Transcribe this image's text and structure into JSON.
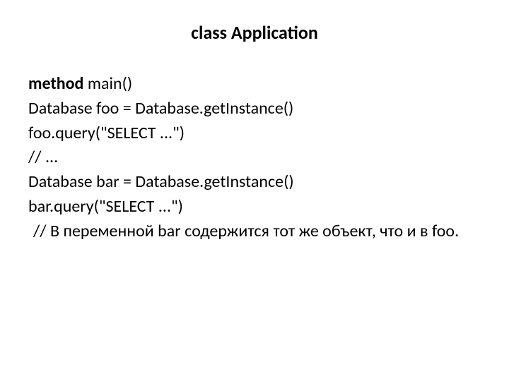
{
  "title": "class Application",
  "lines": {
    "l1_bold": "method",
    "l1_rest": " main()",
    "l2": " Database foo = Database.getInstance()",
    "l3": "foo.query(\"SELECT ...\")",
    "l4": " // ...",
    "l5": "Database bar = Database.getInstance()",
    "l6": " bar.query(\"SELECT ...\")",
    "l7": " // В переменной bar содержится тот же объект, что и в foo."
  }
}
